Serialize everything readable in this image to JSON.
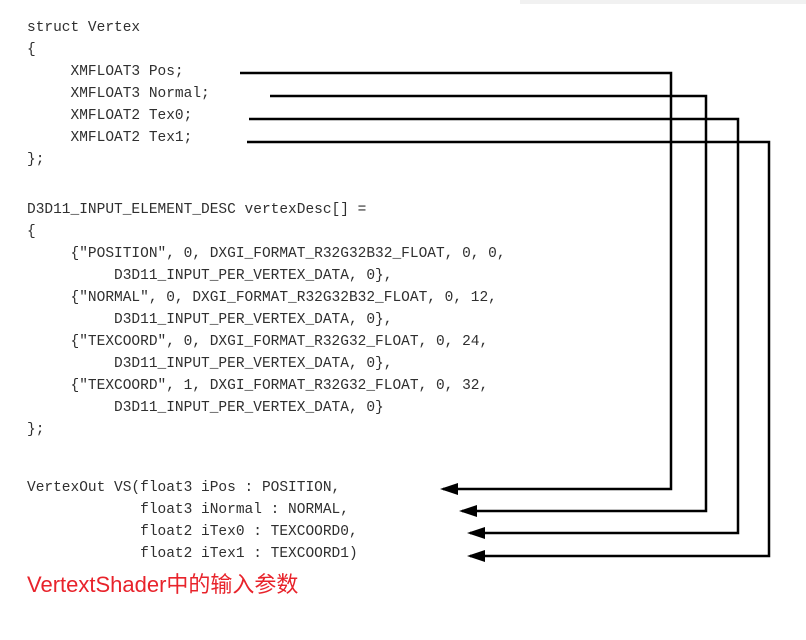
{
  "code": {
    "struct": [
      "struct Vertex",
      "{",
      "     XMFLOAT3 Pos;",
      "     XMFLOAT3 Normal;",
      "     XMFLOAT2 Tex0;",
      "     XMFLOAT2 Tex1;",
      "};"
    ],
    "desc": [
      "D3D11_INPUT_ELEMENT_DESC vertexDesc[] =",
      "{",
      "     {\"POSITION\", 0, DXGI_FORMAT_R32G32B32_FLOAT, 0, 0,",
      "          D3D11_INPUT_PER_VERTEX_DATA, 0},",
      "     {\"NORMAL\", 0, DXGI_FORMAT_R32G32B32_FLOAT, 0, 12,",
      "          D3D11_INPUT_PER_VERTEX_DATA, 0},",
      "     {\"TEXCOORD\", 0, DXGI_FORMAT_R32G32_FLOAT, 0, 24,",
      "          D3D11_INPUT_PER_VERTEX_DATA, 0},",
      "     {\"TEXCOORD\", 1, DXGI_FORMAT_R32G32_FLOAT, 0, 32,",
      "          D3D11_INPUT_PER_VERTEX_DATA, 0}",
      "};"
    ],
    "shader": [
      "VertexOut VS(float3 iPos : POSITION,",
      "             float3 iNormal : NORMAL,",
      "             float2 iTex0 : TEXCOORD0,",
      "             float2 iTex1 : TEXCOORD1)"
    ]
  },
  "caption": "VertextShader中的输入参数",
  "colors": {
    "caption": "#e8232b",
    "code": "#2f2f2f",
    "connector": "#000000"
  }
}
